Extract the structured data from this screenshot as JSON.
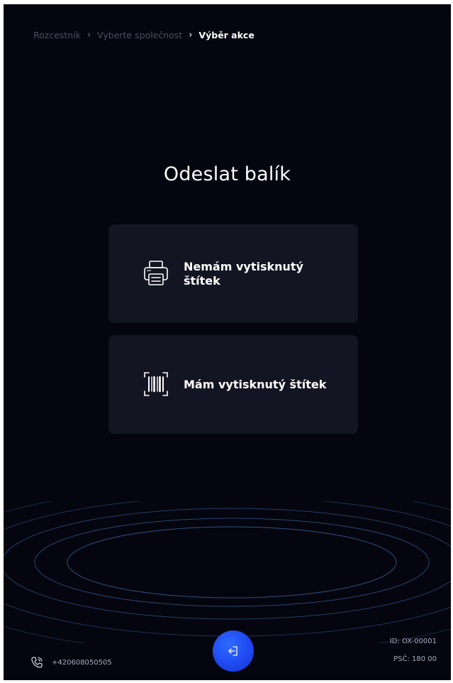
{
  "breadcrumb": {
    "items": [
      "Rozcestník",
      "Vyberte společnost",
      "Výběr akce"
    ],
    "separator": "›"
  },
  "main": {
    "title": "Odeslat balík",
    "options": [
      {
        "label": "Nemám vytisknutý štítek",
        "icon": "printer-icon"
      },
      {
        "label": "Mám vytisknutý štítek",
        "icon": "barcode-scan-icon"
      }
    ]
  },
  "footer": {
    "phone": "+420608050505",
    "phone_icon": "phone-icon",
    "exit_icon": "exit-icon",
    "kiosk_id": "ID: OX-00001",
    "postal_code": "PSČ: 180 00"
  },
  "colors": {
    "background": "#04050f",
    "card": "#141522",
    "accent": "#1f49f0",
    "ring": "#3a5a8c"
  }
}
